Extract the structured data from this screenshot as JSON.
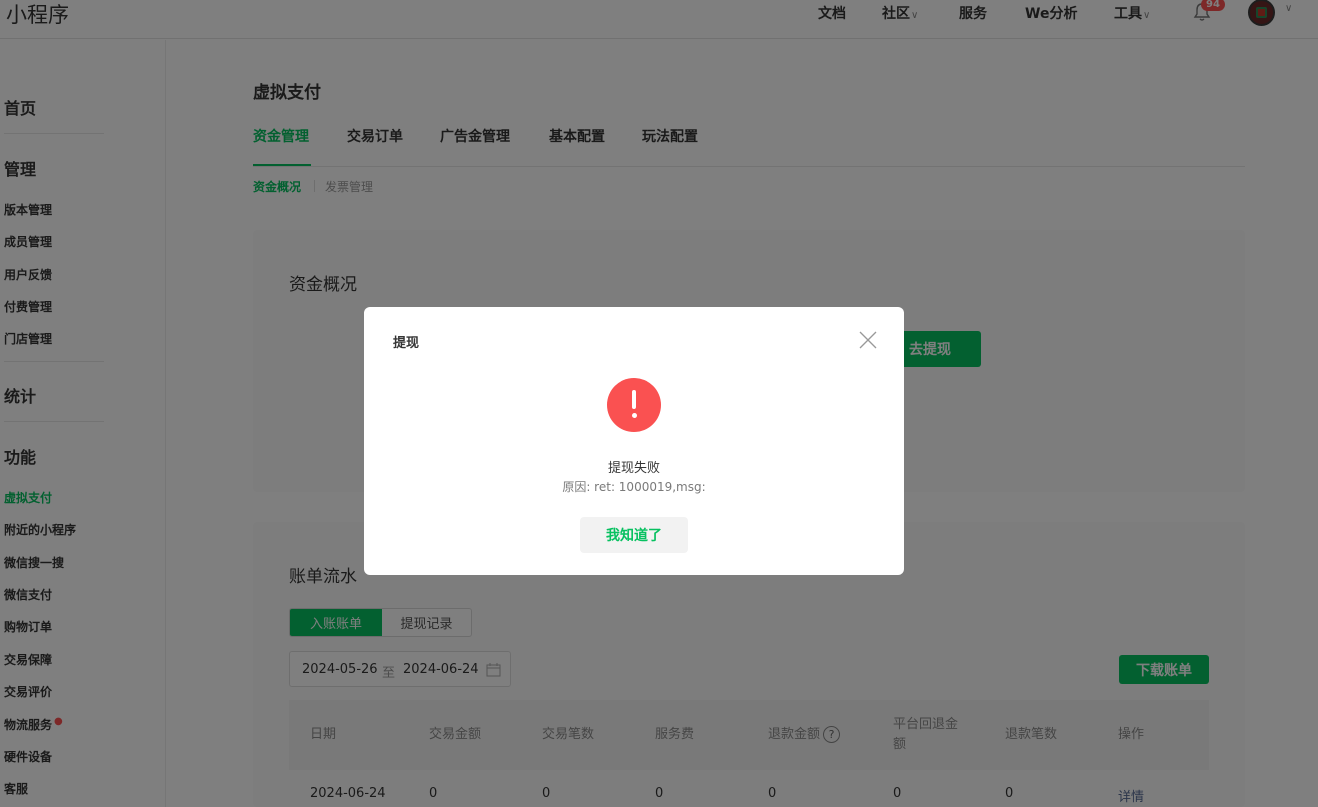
{
  "app": {
    "title": "小程序"
  },
  "topnav": {
    "docs": "文档",
    "community": "社区",
    "services": "服务",
    "analytics": "We分析",
    "tools": "工具",
    "notifications_count": "94",
    "icons": {
      "notifications": "bell-icon",
      "avatar": "user-avatar",
      "dropdown": "chevron-down-icon"
    }
  },
  "sidebar": {
    "home": "首页",
    "manage": {
      "title": "管理",
      "items": [
        "版本管理",
        "成员管理",
        "用户反馈",
        "付费管理",
        "门店管理"
      ]
    },
    "stats": "统计",
    "features": {
      "title": "功能",
      "items": [
        "虚拟支付",
        "附近的小程序",
        "微信搜一搜",
        "微信支付",
        "购物订单",
        "交易保障",
        "交易评价",
        "物流服务",
        "硬件设备",
        "客服"
      ],
      "active": "虚拟支付"
    }
  },
  "main": {
    "title": "虚拟支付",
    "tabs": [
      "资金管理",
      "交易订单",
      "广告金管理",
      "基本配置",
      "玩法配置"
    ],
    "active_tab": "资金管理",
    "subtabs": [
      "资金概况",
      "发票管理"
    ],
    "active_subtab": "资金概况",
    "fund_overview": {
      "title": "资金概况",
      "withdraw_button": "去提现"
    },
    "ledger": {
      "title": "账单流水",
      "segments": [
        "入账账单",
        "提现记录"
      ],
      "active_segment": "入账账单",
      "date_start": "2024-05-26",
      "date_sep": "至",
      "date_end": "2024-06-24",
      "download_button": "下载账单",
      "columns": [
        "日期",
        "交易金额",
        "交易笔数",
        "服务费",
        "退款金额",
        "平台回退金额",
        "退款笔数",
        "操作"
      ],
      "rows": [
        {
          "date": "2024-06-24",
          "amount": "0",
          "count": "0",
          "fee": "0",
          "refund": "0",
          "platform_refund": "0",
          "refund_count": "0",
          "action": "详情"
        }
      ]
    }
  },
  "dialog": {
    "title": "提现",
    "message": "提现失败",
    "reason": "原因: ret: 1000019,msg:",
    "confirm": "我知道了",
    "icon": "warning-icon"
  },
  "colors": {
    "accent": "#07c160",
    "danger": "#fa5151",
    "link": "#576b95"
  }
}
